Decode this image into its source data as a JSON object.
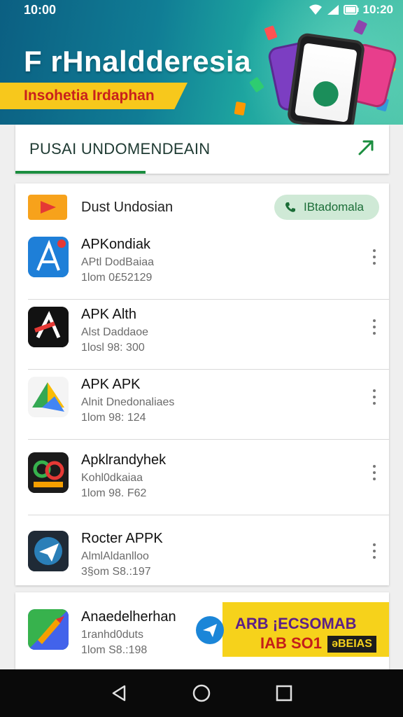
{
  "status": {
    "time": "10:00",
    "time_right": "10:20"
  },
  "hero": {
    "title": "F rHnaldderesia",
    "subtitle": "Insohetia Irdaphan"
  },
  "tabs": {
    "active_label": "PUSAI UNDOMENDEAIN"
  },
  "section": {
    "title": "Dust Undosian",
    "action_label": "IBtadomala"
  },
  "apps": [
    {
      "name": "APKondiak",
      "developer": "APtl DodBaiaa",
      "meta": "1lom 0£52129"
    },
    {
      "name": "APK Alth",
      "developer": "Alst Daddaoe",
      "meta": "1losl 98: 300"
    },
    {
      "name": "APK APK",
      "developer": "Alnit Dnedonaliaes",
      "meta": "1lom 98: 124"
    },
    {
      "name": "Apklrandyhek",
      "developer": "Kohl0dkaiaa",
      "meta": "1lom 98. F62"
    },
    {
      "name": "Rocter APPK",
      "developer": "AlmlAldanlloo",
      "meta": "3§om S8.:197"
    },
    {
      "name": "Anaedelherhan",
      "developer": "1ranhd0duts",
      "meta": "1lom S8.:198"
    }
  ],
  "ad": {
    "line1": "ARB ¡ECSOMAB",
    "line2": "IAB SO1",
    "tag": "əBEIAS"
  },
  "colors": {
    "accent": "#1b8e3f",
    "banner_yellow": "#f7c81c",
    "hero_blue": "#0b5f82"
  },
  "icons": {
    "status": [
      "wifi-icon",
      "signal-icon",
      "battery-icon"
    ],
    "tab_action": "send-arrow-icon",
    "section": "play-icon",
    "pill": "phone-icon",
    "more": "more-vert-icon",
    "nav": [
      "back-icon",
      "home-icon",
      "recents-icon"
    ]
  }
}
